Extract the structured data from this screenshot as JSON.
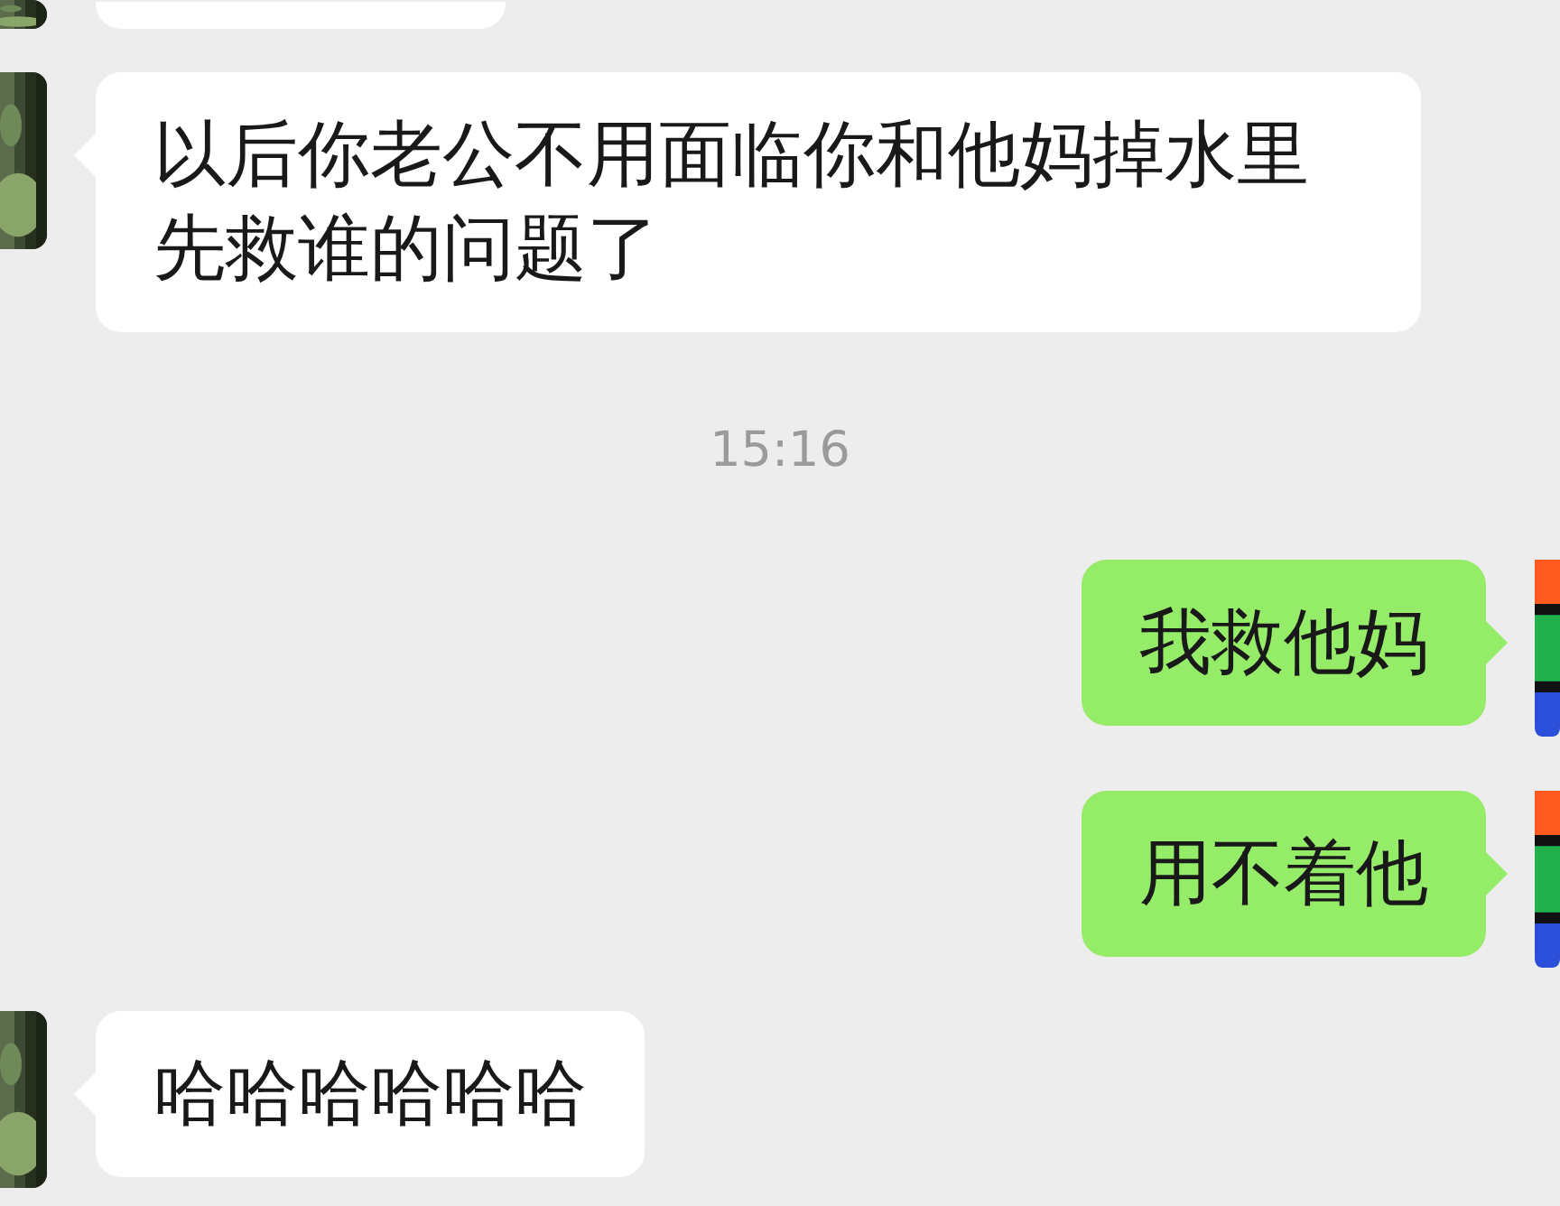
{
  "messages": [
    {
      "kind": "incoming_tail"
    },
    {
      "kind": "incoming",
      "text": "以后你老公不用面临你和他妈掉水里先救谁的问题了"
    },
    {
      "kind": "time",
      "text": "15:16"
    },
    {
      "kind": "outgoing",
      "text": "我救他妈"
    },
    {
      "kind": "outgoing",
      "text": "用不着他"
    },
    {
      "kind": "incoming",
      "text": "哈哈哈哈哈哈"
    }
  ]
}
